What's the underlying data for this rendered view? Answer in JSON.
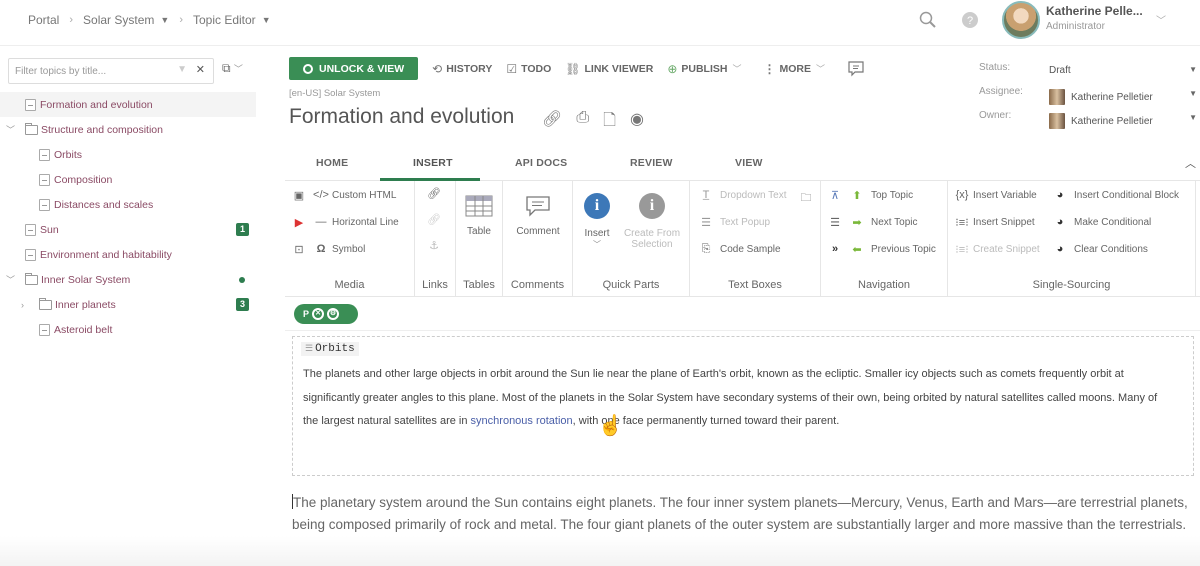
{
  "topbar": {
    "breadcrumbs": [
      {
        "label": "Portal",
        "has_dropdown": false
      },
      {
        "label": "Solar System",
        "has_dropdown": true
      },
      {
        "label": "Topic Editor",
        "has_dropdown": true
      }
    ],
    "icons": [
      "search-icon",
      "help-icon"
    ],
    "user": {
      "name": "Katherine Pelle...",
      "role": "Administrator"
    }
  },
  "sidebar": {
    "filter_placeholder": "Filter topics by title...",
    "tree": [
      {
        "label": "Formation and evolution",
        "type": "topic",
        "level": 0,
        "selected": true
      },
      {
        "label": "Structure and composition",
        "type": "folder",
        "level": 0,
        "expanded": true
      },
      {
        "label": "Orbits",
        "type": "topic",
        "level": 1
      },
      {
        "label": "Composition",
        "type": "topic",
        "level": 1
      },
      {
        "label": "Distances and scales",
        "type": "topic",
        "level": 1
      },
      {
        "label": "Sun",
        "type": "topic",
        "level": 0,
        "badge": "1"
      },
      {
        "label": "Environment and habitability",
        "type": "topic",
        "level": 0
      },
      {
        "label": "Inner Solar System",
        "type": "folder",
        "level": 0,
        "expanded": true,
        "dot": true
      },
      {
        "label": "Inner planets",
        "type": "folder",
        "level": 1,
        "expanded": false,
        "badge": "3"
      },
      {
        "label": "Asteroid belt",
        "type": "topic",
        "level": 1
      }
    ]
  },
  "toolbar": {
    "unlock_label": "UNLOCK & VIEW",
    "history_label": "HISTORY",
    "todo_label": "TODO",
    "link_viewer_label": "LINK VIEWER",
    "publish_label": "PUBLISH",
    "more_label": "MORE"
  },
  "topic": {
    "lang_path": "[en-US] Solar System",
    "title": "Formation and evolution"
  },
  "meta": {
    "status_label": "Status:",
    "status_value": "Draft",
    "assignee_label": "Assignee:",
    "assignee_value": "Katherine Pelletier",
    "owner_label": "Owner:",
    "owner_value": "Katherine Pelletier"
  },
  "ribbon": {
    "tabs": [
      "HOME",
      "INSERT",
      "API DOCS",
      "REVIEW",
      "VIEW"
    ],
    "active_tab": "INSERT",
    "groups": {
      "media": {
        "label": "Media",
        "items": [
          "Custom HTML",
          "Horizontal Line",
          "Symbol"
        ]
      },
      "links": {
        "label": "Links"
      },
      "tables": {
        "label": "Tables",
        "table": "Table"
      },
      "comments": {
        "label": "Comments",
        "comment": "Comment"
      },
      "quick_parts": {
        "label": "Quick Parts",
        "insert": "Insert",
        "create_from": "Create From",
        "selection": "Selection"
      },
      "text_boxes": {
        "label": "Text Boxes",
        "items": [
          "Dropdown Text",
          "Text Popup",
          "Code Sample"
        ]
      },
      "navigation": {
        "label": "Navigation",
        "items": [
          "Top Topic",
          "Next Topic",
          "Previous Topic"
        ]
      },
      "single_sourcing": {
        "label": "Single-Sourcing",
        "items": [
          "Insert Variable",
          "Insert Snippet",
          "Create Snippet",
          "Insert Conditional Block",
          "Make Conditional",
          "Clear Conditions"
        ]
      }
    }
  },
  "editor": {
    "tag": "P",
    "snippet_title": "Orbits",
    "snippet_text_before": "The planets and other large objects in orbit around the Sun lie near the plane of Earth's orbit, known as the ecliptic. Smaller icy objects such as comets frequently orbit at significantly greater angles to this plane. Most of the planets in the Solar System have secondary systems of their own, being orbited by natural satellites called moons. Many of the largest natural satellites are in ",
    "snippet_link": "synchronous rotation",
    "snippet_text_after": ", with one face permanently turned toward their parent.",
    "body": "The planetary system around the Sun contains eight planets. The four inner system planets—Mercury, Venus, Earth and Mars—are terrestrial planets, being composed primarily of rock and metal. The four giant planets of the outer system are substantially larger and more massive than the terrestrials."
  },
  "colors": {
    "accent": "#3a8e55",
    "badge": "#2e7d4f",
    "link": "#4a5fa8",
    "tree_text": "#8a4a64"
  }
}
